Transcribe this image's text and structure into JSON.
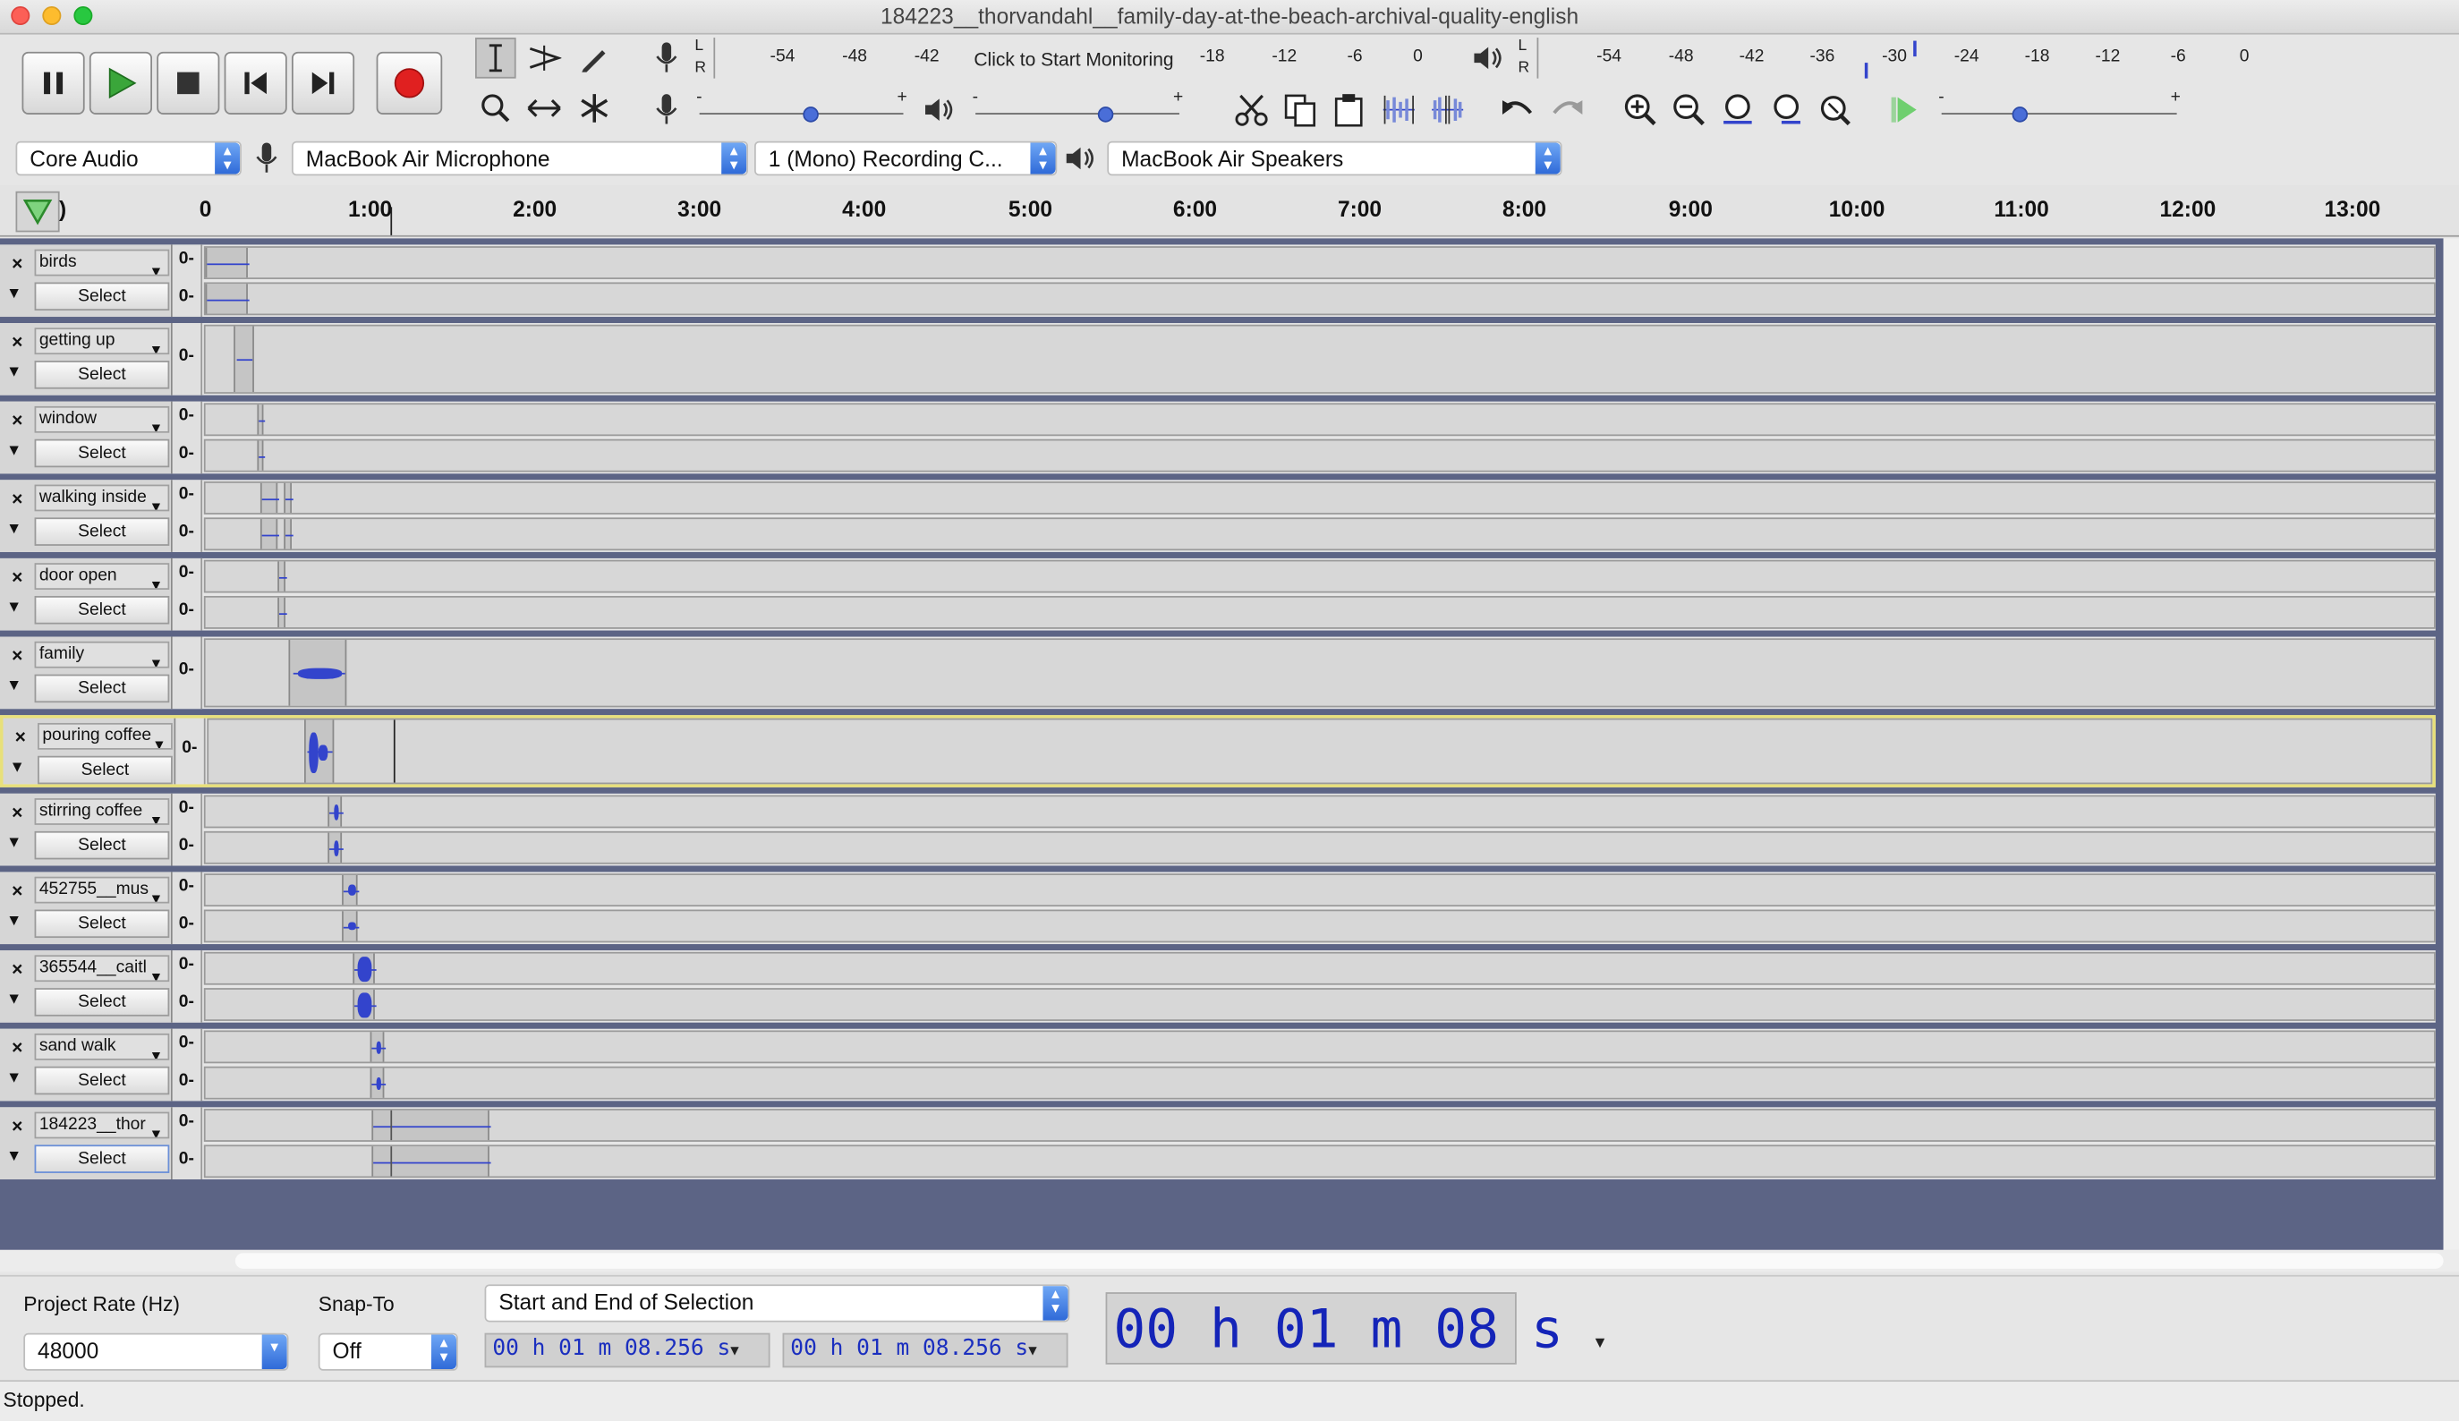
{
  "window": {
    "title": "184223__thorvandahl__family-day-at-the-beach-archival-quality-english"
  },
  "meters": {
    "record_lr": "L R",
    "record_ticks": [
      "-54",
      "-48",
      "-42",
      "-18",
      "-12",
      "-6",
      "0"
    ],
    "record_prompt": "Click to Start Monitoring",
    "play_ticks": [
      "-54",
      "-48",
      "-42",
      "-36",
      "-30",
      "-24",
      "-18",
      "-12",
      "-6",
      "0"
    ],
    "slider_minus": "-",
    "slider_plus": "+"
  },
  "device_toolbar": {
    "host": "Core Audio",
    "recording_device": "MacBook Air Microphone",
    "channels": "1 (Mono) Recording C...",
    "playback_device": "MacBook Air Speakers"
  },
  "timeline": {
    "ticks": [
      "0",
      "1:00",
      "2:00",
      "3:00",
      "4:00",
      "5:00",
      "6:00",
      "7:00",
      "8:00",
      "9:00",
      "10:00",
      "11:00",
      "12:00",
      "13:00"
    ],
    "lead_label": ")"
  },
  "track_common": {
    "select_label": "Select",
    "zero_label": "0-",
    "close_label": "×"
  },
  "tracks": [
    {
      "name": "birds"
    },
    {
      "name": "getting up"
    },
    {
      "name": "window"
    },
    {
      "name": "walking inside"
    },
    {
      "name": "door open"
    },
    {
      "name": "family"
    },
    {
      "name": "pouring coffee"
    },
    {
      "name": "stirring coffee"
    },
    {
      "name": "452755__mus"
    },
    {
      "name": "365544__caitl"
    },
    {
      "name": "sand walk"
    },
    {
      "name": "184223__thor"
    }
  ],
  "selection_toolbar": {
    "project_rate_label": "Project Rate (Hz)",
    "project_rate_value": "48000",
    "snap_to_label": "Snap-To",
    "snap_to_value": "Off",
    "selection_mode": "Start and End of Selection",
    "start_time": "00 h 01 m 08.256 s",
    "end_time": "00 h 01 m 08.256 s"
  },
  "audio_position": {
    "hh": "00",
    "h": "h",
    "mm": "01",
    "m": "m",
    "ss": "08",
    "s": "s"
  },
  "status": {
    "text": "Stopped."
  },
  "colors": {
    "waveform": "#3344cc",
    "selected_track_border": "#e8e07a",
    "record_red": "#e02020",
    "play_green": "#3aa63a"
  }
}
